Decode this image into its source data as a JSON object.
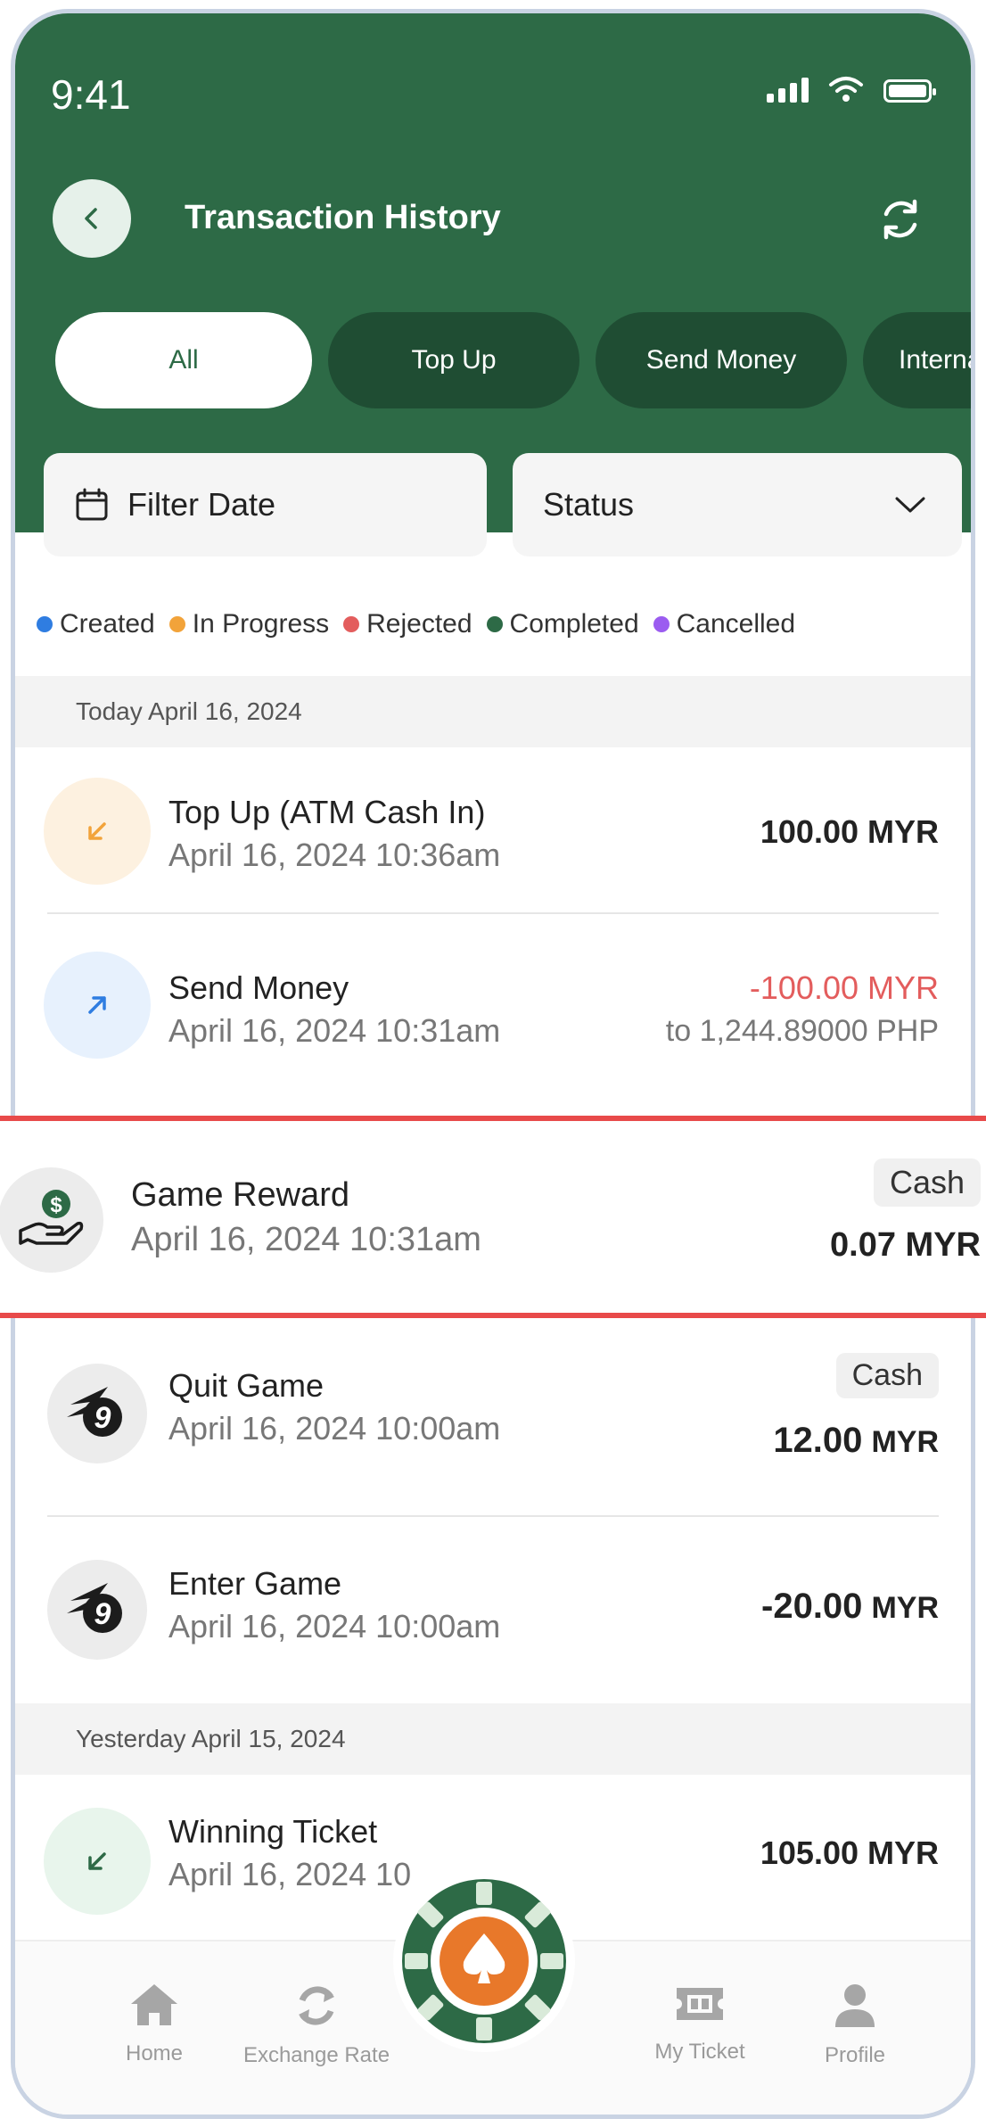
{
  "status_bar": {
    "time": "9:41"
  },
  "header": {
    "title": "Transaction History"
  },
  "tabs": [
    {
      "label": "All",
      "active": true
    },
    {
      "label": "Top Up",
      "active": false
    },
    {
      "label": "Send Money",
      "active": false
    },
    {
      "label": "Internal",
      "active": false
    }
  ],
  "filters": {
    "date_label": "Filter Date",
    "status_label": "Status"
  },
  "legend": [
    {
      "label": "Created",
      "color": "#2f7de1"
    },
    {
      "label": "In Progress",
      "color": "#f2a33a"
    },
    {
      "label": "Rejected",
      "color": "#e35d5d"
    },
    {
      "label": "Completed",
      "color": "#2d6a46"
    },
    {
      "label": "Cancelled",
      "color": "#9b5cf0"
    }
  ],
  "sections": [
    {
      "label": "Today  April 16, 2024"
    },
    {
      "label": "Yesterday  April 15, 2024"
    }
  ],
  "transactions": [
    {
      "title": "Top Up (ATM Cash In)",
      "date": "April 16, 2024  10:36am",
      "amount": "100.00 MYR",
      "icon": "arrow-down-left-icon"
    },
    {
      "title": "Send Money",
      "date": "April 16, 2024  10:31am",
      "amount": "-100.00 MYR",
      "sub": "to 1,244.89000 PHP",
      "icon": "arrow-up-right-icon"
    },
    {
      "title": "Game Reward",
      "date": "April 16, 2024  10:31am",
      "badge": "Cash",
      "amount": "0.07 MYR",
      "icon": "money-hand-icon"
    },
    {
      "title": "Quit Game",
      "date": "April 16, 2024  10:00am",
      "badge": "Cash",
      "amount_value": "12.00",
      "amount_unit": "MYR",
      "icon": "game-logo-icon"
    },
    {
      "title": "Enter Game",
      "date": "April 16, 2024  10:00am",
      "amount_value": "-20.00",
      "amount_unit": "MYR",
      "icon": "game-logo-icon"
    },
    {
      "title": "Winning Ticket",
      "date": "April 16, 2024  10",
      "amount": "105.00 MYR",
      "icon": "arrow-down-left-icon"
    }
  ],
  "bottom_nav": [
    {
      "label": "Home",
      "icon": "home-icon"
    },
    {
      "label": "Exchange Rate",
      "icon": "exchange-icon"
    },
    {
      "label": "My Ticket",
      "icon": "ticket-icon"
    },
    {
      "label": "Profile",
      "icon": "profile-icon"
    }
  ],
  "colors": {
    "header_green": "#2d6a46",
    "tab_dark": "#1f4d33",
    "negative_red": "#e35d5d",
    "highlight_border": "#e84a4a"
  }
}
